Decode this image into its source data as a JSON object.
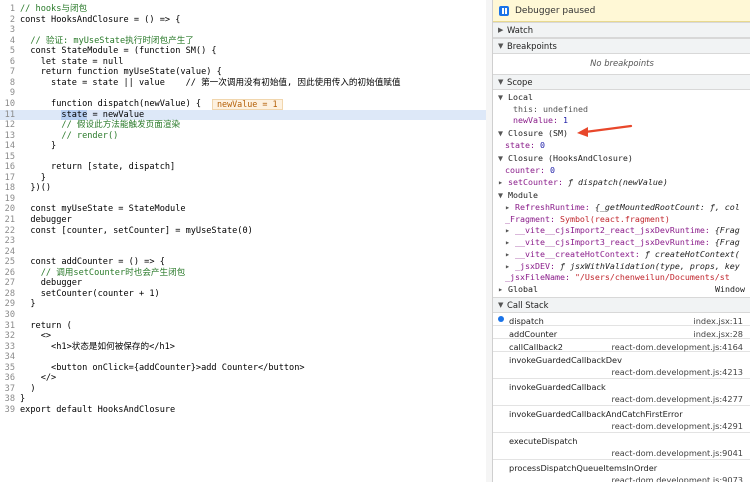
{
  "editor": {
    "lines": [
      {
        "n": "1",
        "code": "// hooks与闭包",
        "cls": "cm"
      },
      {
        "n": "2",
        "code": "const HooksAndClosure = () => {"
      },
      {
        "n": "3",
        "code": ""
      },
      {
        "n": "4",
        "code": "  // 验证: myUseState执行时闭包产生了",
        "cls": "cm"
      },
      {
        "n": "5",
        "code": "  const StateModule = (function SM() {"
      },
      {
        "n": "6",
        "code": "    let state = null"
      },
      {
        "n": "7",
        "code": "    return function myUseState(value) {"
      },
      {
        "n": "8",
        "code": "      state = state || value    // 第一次调用没有初始值, 因此使用传入的初始值赋值"
      },
      {
        "n": "9",
        "code": ""
      },
      {
        "n": "10",
        "code": "      function dispatch(newValue) {"
      },
      {
        "n": "11",
        "code": "        state = newValue"
      },
      {
        "n": "12",
        "code": "        // 假设此方法能触发页面渲染",
        "cls": "cm"
      },
      {
        "n": "13",
        "code": "        // render()",
        "cls": "cm"
      },
      {
        "n": "14",
        "code": "      }"
      },
      {
        "n": "15",
        "code": ""
      },
      {
        "n": "16",
        "code": "      return [state, dispatch]"
      },
      {
        "n": "17",
        "code": "    }"
      },
      {
        "n": "18",
        "code": "  })()"
      },
      {
        "n": "19",
        "code": ""
      },
      {
        "n": "20",
        "code": "  const myUseState = StateModule"
      },
      {
        "n": "21",
        "code": "  debugger"
      },
      {
        "n": "22",
        "code": "  const [counter, setCounter] = myUseState(0)"
      },
      {
        "n": "23",
        "code": ""
      },
      {
        "n": "24",
        "code": ""
      },
      {
        "n": "25",
        "code": "  const addCounter = () => {"
      },
      {
        "n": "26",
        "code": "    // 调用setCounter时也会产生闭包",
        "cls": "cm"
      },
      {
        "n": "27",
        "code": "    debugger"
      },
      {
        "n": "28",
        "code": "    setCounter(counter + 1)"
      },
      {
        "n": "29",
        "code": "  }"
      },
      {
        "n": "30",
        "code": ""
      },
      {
        "n": "31",
        "code": "  return ("
      },
      {
        "n": "32",
        "code": "    <>"
      },
      {
        "n": "33",
        "code": "      <h1>状态是如何被保存的</h1>"
      },
      {
        "n": "34",
        "code": ""
      },
      {
        "n": "35",
        "code": "      <button onClick={addCounter}>add Counter</button>"
      },
      {
        "n": "36",
        "code": "    </>"
      },
      {
        "n": "37",
        "code": "  )"
      },
      {
        "n": "38",
        "code": "}"
      },
      {
        "n": "39",
        "code": "export default HooksAndClosure"
      }
    ],
    "inline_value": "newValue = 1",
    "paused_line": "11",
    "selected_token": "state"
  },
  "panel": {
    "paused_label": "Debugger paused",
    "sections": {
      "watch": "Watch",
      "breakpoints": "Breakpoints",
      "breakpoints_empty": "No breakpoints",
      "scope": "Scope",
      "call_stack": "Call Stack"
    },
    "scope": {
      "local_label": "Local",
      "local_this_key": "this:",
      "local_this_val": "undefined",
      "local_newValue_key": "newValue:",
      "local_newValue_val": "1",
      "closure_sm_label": "Closure (SM)",
      "closure_sm_state_key": "state:",
      "closure_sm_state_val": "0",
      "closure_hc_label": "Closure (HooksAndClosure)",
      "closure_hc_counter_key": "counter:",
      "closure_hc_counter_val": "0",
      "closure_hc_setCounter_key": "setCounter:",
      "closure_hc_setCounter_val": "ƒ dispatch(newValue)",
      "module_label": "Module",
      "module_items": [
        {
          "key": "RefreshRuntime:",
          "val": "{_getMountedRootCount: ƒ, col"
        },
        {
          "key": "_Fragment:",
          "val": "Symbol(react.fragment)"
        },
        {
          "key": "__vite__cjsImport2_react_jsxDevRuntime:",
          "val": "{Frag"
        },
        {
          "key": "__vite__cjsImport3_react_jsxDevRuntime:",
          "val": "{Frag"
        },
        {
          "key": "__vite__createHotContext:",
          "val": "ƒ createHotContext("
        },
        {
          "key": "_jsxDEV:",
          "val": "ƒ jsxWithValidation(type, props, key"
        },
        {
          "key": "_jsxFileName:",
          "val": "\"/Users/chenweilun/Documents/st"
        }
      ],
      "global_label": "Global",
      "global_val": "Window"
    },
    "call_stack": [
      {
        "name": "dispatch",
        "loc": "index.jsx:11"
      },
      {
        "name": "addCounter",
        "loc": "index.jsx:28"
      },
      {
        "name": "callCallback2",
        "loc": "react-dom.development.js:4164"
      },
      {
        "name": "invokeGuardedCallbackDev",
        "loc": "react-dom.development.js:4213"
      },
      {
        "name": "invokeGuardedCallback",
        "loc": "react-dom.development.js:4277"
      },
      {
        "name": "invokeGuardedCallbackAndCatchFirstError",
        "loc": "react-dom.development.js:4291"
      },
      {
        "name": "executeDispatch",
        "loc": "react-dom.development.js:9041"
      },
      {
        "name": "processDispatchQueueItemsInOrder",
        "loc": "react-dom.development.js:9073"
      }
    ]
  },
  "colors": {
    "accent": "#1a73e8",
    "annotation_arrow": "#e8472b",
    "paused_bg": "#fff8d6"
  }
}
